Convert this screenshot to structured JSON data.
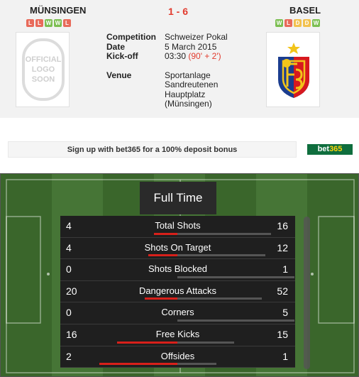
{
  "match": {
    "home_team": "MÜNSINGEN",
    "away_team": "BASEL",
    "score": "1 - 6",
    "home_form": [
      "L",
      "L",
      "W",
      "W",
      "L"
    ],
    "away_form": [
      "W",
      "L",
      "D",
      "D",
      "W"
    ],
    "home_logo_text": [
      "OFFICIAL",
      "LOGO",
      "SOON"
    ]
  },
  "info": {
    "competition_label": "Competition",
    "competition_value": "Schweizer Pokal",
    "date_label": "Date",
    "date_value": "5 March 2015",
    "kickoff_label": "Kick-off",
    "kickoff_time": "03:30",
    "kickoff_extra": "(90' + 2')",
    "venue_label": "Venue",
    "venue_lines": [
      "Sportanlage",
      "Sandreutenen",
      "Hauptplatz",
      "(Münsingen)"
    ]
  },
  "ad": {
    "text": "Sign up with bet365 for a 100% deposit bonus",
    "brand_a": "bet",
    "brand_b": "365"
  },
  "stats_panel": {
    "title": "Full Time",
    "rows": [
      {
        "label": "Total Shots",
        "home": "4",
        "away": "16"
      },
      {
        "label": "Shots On Target",
        "home": "4",
        "away": "12"
      },
      {
        "label": "Shots Blocked",
        "home": "0",
        "away": "1"
      },
      {
        "label": "Dangerous Attacks",
        "home": "20",
        "away": "52"
      },
      {
        "label": "Corners",
        "home": "0",
        "away": "5"
      },
      {
        "label": "Free Kicks",
        "home": "16",
        "away": "15"
      },
      {
        "label": "Offsides",
        "home": "2",
        "away": "1"
      }
    ]
  },
  "colors": {
    "win": "#7cbf52",
    "loss": "#e86a5a",
    "draw": "#f2c14e",
    "accent_red": "#e23b2e",
    "pitch_dark": "#3a662b",
    "pitch_light": "#467536"
  }
}
